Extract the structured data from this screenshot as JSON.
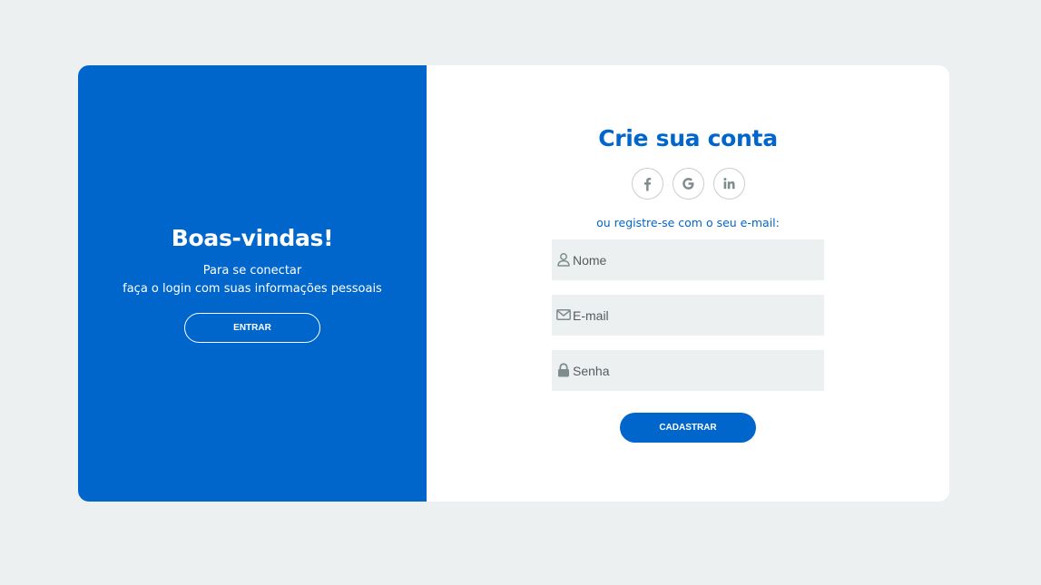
{
  "colors": {
    "page_background": "#ecf0f1",
    "brand_blue": "#0066cc",
    "card_background": "#ffffff",
    "input_background": "#ecf0f1",
    "icon_gray": "#7f8c8d"
  },
  "welcome": {
    "title": "Boas-vindas!",
    "line1": "Para se conectar",
    "line2": "faça o login com suas informações pessoais",
    "button_label": "ENTRAR"
  },
  "signup": {
    "title": "Crie sua conta",
    "social": [
      {
        "name": "facebook",
        "icon": "facebook-icon"
      },
      {
        "name": "google",
        "icon": "google-icon"
      },
      {
        "name": "linkedin",
        "icon": "linkedin-icon"
      }
    ],
    "note": "ou registre-se com o seu e-mail:",
    "fields": {
      "name": {
        "placeholder": "Nome",
        "value": "",
        "icon": "user-icon"
      },
      "email": {
        "placeholder": "E-mail",
        "value": "",
        "icon": "envelope-icon"
      },
      "password": {
        "placeholder": "Senha",
        "value": "",
        "icon": "lock-icon"
      }
    },
    "button_label": "CADASTRAR"
  }
}
